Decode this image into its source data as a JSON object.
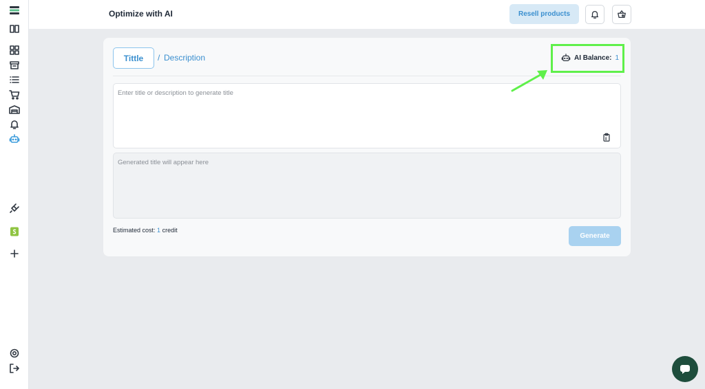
{
  "header": {
    "title": "Optimize with AI",
    "resell_label": "Resell products",
    "icons": [
      "bell-icon",
      "cart-icon"
    ]
  },
  "sidebar": {
    "top_icons": [
      "logo-icon",
      "book-icon",
      "dashboard-icon",
      "archive-icon",
      "list-icon",
      "cart-icon",
      "warehouse-icon",
      "bell-icon",
      "robot-icon"
    ],
    "active": "robot-icon",
    "middle_icons": [
      "plug-icon",
      "shopify-icon",
      "plus-icon"
    ],
    "bottom_icons": [
      "settings-icon",
      "logout-icon"
    ]
  },
  "card": {
    "tab_title": "Tittle",
    "tab_separator": "/",
    "tab_description": "Description",
    "balance_label": "AI Balance:",
    "balance_value": "1",
    "input_placeholder": "Enter title or description to generate title",
    "output_placeholder": "Generated title will appear here",
    "cost_label": "Estimated cost:",
    "cost_value": "1",
    "cost_unit": "credit",
    "generate_label": "Generate"
  },
  "colors": {
    "accent": "#3a8fcf",
    "highlight": "#5ff04a",
    "fab": "#1e4d3c"
  }
}
